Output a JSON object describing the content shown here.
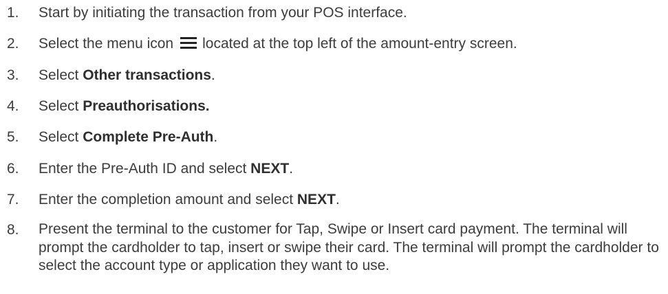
{
  "steps": [
    {
      "number": "1.",
      "text": "Start by initiating the transaction from your POS interface."
    },
    {
      "number": "2.",
      "before": "Select the menu icon",
      "icon": "menu-icon",
      "after": "located at the top left of the amount-entry screen."
    },
    {
      "number": "3.",
      "before": "Select ",
      "bold": "Other transactions",
      "after": "."
    },
    {
      "number": "4.",
      "before": "Select ",
      "bold": "Preauthorisations.",
      "after": ""
    },
    {
      "number": "5.",
      "before": "Select ",
      "bold": "Complete Pre-Auth",
      "after": "."
    },
    {
      "number": "6.",
      "before": "Enter the Pre-Auth ID and select ",
      "bold": "NEXT",
      "after": "."
    },
    {
      "number": "7.",
      "before": "Enter the completion amount and select ",
      "bold": "NEXT",
      "after": "."
    },
    {
      "number": "8.",
      "text": "Present the terminal to the customer for Tap, Swipe or Insert card payment. The terminal will prompt the cardholder to tap, insert or swipe their card. The terminal will prompt the cardholder to select the account type or application they want to use."
    }
  ]
}
